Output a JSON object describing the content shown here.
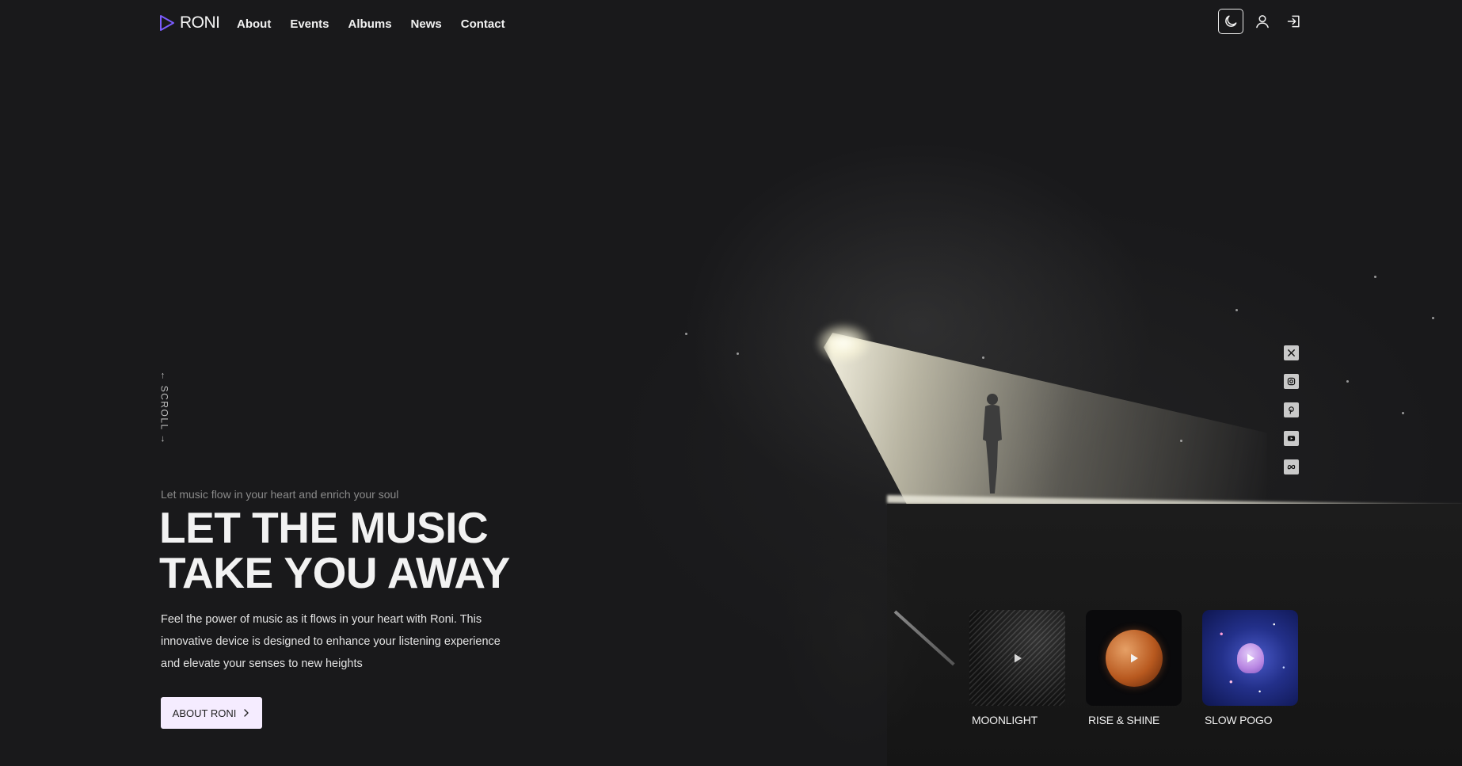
{
  "brand": {
    "name": "RONI",
    "accent": "#7b5cff"
  },
  "nav": {
    "items": [
      {
        "label": "About"
      },
      {
        "label": "Events"
      },
      {
        "label": "Albums"
      },
      {
        "label": "News"
      },
      {
        "label": "Contact"
      }
    ]
  },
  "header_actions": [
    {
      "icon": "moon-icon",
      "active": true
    },
    {
      "icon": "user-icon",
      "active": false
    },
    {
      "icon": "login-icon",
      "active": false
    }
  ],
  "scroll": {
    "label": "SCROLL"
  },
  "hero": {
    "eyebrow": "Let music flow in your heart and enrich your soul",
    "headline_line1": "LET THE MUSIC",
    "headline_line2": "TAKE YOU AWAY",
    "description": "Feel the power of music as it flows in your heart with Roni. This innovative device is designed to enhance your listening experience and elevate your senses to new heights",
    "cta_label": "ABOUT RONI",
    "cta_bg": "#f5ecff"
  },
  "socials": [
    {
      "icon": "x-icon"
    },
    {
      "icon": "instagram-icon"
    },
    {
      "icon": "pinterest-icon"
    },
    {
      "icon": "youtube-icon"
    },
    {
      "icon": "meta-icon"
    }
  ],
  "albums": [
    {
      "title": "MOONLIGHT"
    },
    {
      "title": "RISE & SHINE"
    },
    {
      "title": "SLOW POGO"
    }
  ]
}
